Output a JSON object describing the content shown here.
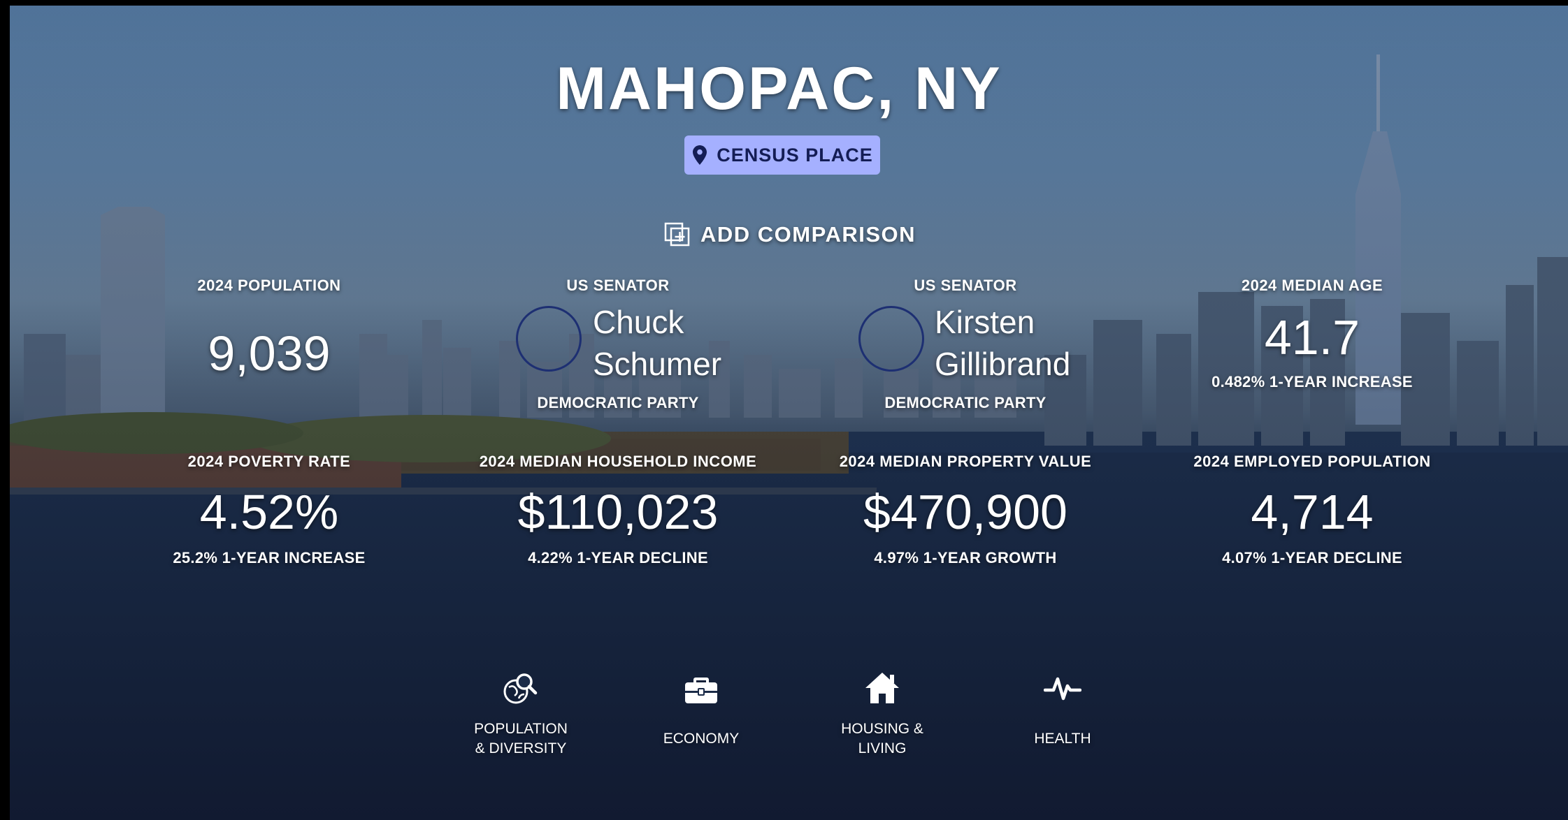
{
  "page": {
    "title": "MAHOPAC, NY",
    "badge": {
      "icon": "map-pin-icon",
      "label": "CENSUS PLACE"
    },
    "add_comparison": {
      "icon": "add-comparison-icon",
      "label": "ADD COMPARISON"
    }
  },
  "stats_row1": {
    "population": {
      "label": "2024 POPULATION",
      "value": "9,039"
    },
    "senator1": {
      "label": "US SENATOR",
      "first": "Chuck",
      "last": "Schumer",
      "party": "DEMOCRATIC PARTY"
    },
    "senator2": {
      "label": "US SENATOR",
      "first": "Kirsten",
      "last": "Gillibrand",
      "party": "DEMOCRATIC PARTY"
    },
    "median_age": {
      "label": "2024 MEDIAN AGE",
      "value": "41.7",
      "change": "0.482% 1-YEAR INCREASE"
    }
  },
  "stats_row2": {
    "poverty": {
      "label": "2024 POVERTY RATE",
      "value": "4.52%",
      "change": "25.2% 1-YEAR INCREASE"
    },
    "income": {
      "label": "2024 MEDIAN HOUSEHOLD INCOME",
      "value": "$110,023",
      "change": "4.22% 1-YEAR DECLINE"
    },
    "property": {
      "label": "2024 MEDIAN PROPERTY VALUE",
      "value": "$470,900",
      "change": "4.97% 1-YEAR GROWTH"
    },
    "employed": {
      "label": "2024 EMPLOYED POPULATION",
      "value": "4,714",
      "change": "4.07% 1-YEAR DECLINE"
    }
  },
  "categories": [
    {
      "icon": "population-diversity-icon",
      "line1": "POPULATION",
      "line2": "& DIVERSITY"
    },
    {
      "icon": "briefcase-icon",
      "line1": "ECONOMY",
      "line2": ""
    },
    {
      "icon": "house-icon",
      "line1": "HOUSING &",
      "line2": "LIVING"
    },
    {
      "icon": "heartbeat-icon",
      "line1": "HEALTH",
      "line2": ""
    }
  ],
  "colors": {
    "badge_bg": "#a5b0ff",
    "badge_text": "#141d55",
    "senator_ring": "#1d2f72"
  }
}
